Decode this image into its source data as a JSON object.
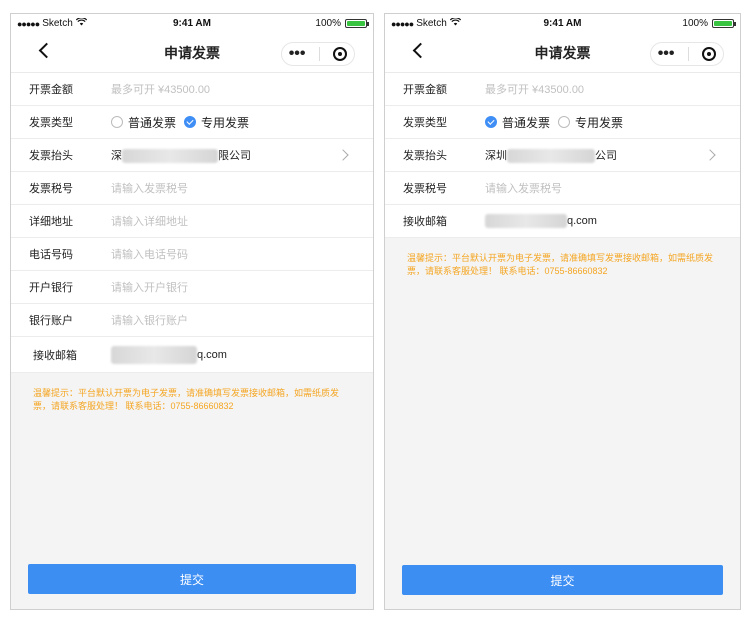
{
  "status_bar": {
    "carrier": "Sketch",
    "time": "9:41 AM",
    "battery": "100%"
  },
  "nav": {
    "title": "申请发票",
    "more_label": "•••"
  },
  "left_screen": {
    "rows": {
      "amount_label": "开票金额",
      "amount_placeholder": "最多可开 ¥43500.00",
      "type_label": "发票类型",
      "type_option_normal": "普通发票",
      "type_option_special": "专用发票",
      "selected_type": "专用发票",
      "header_label": "发票抬头",
      "header_value_prefix": "深",
      "header_value_suffix": "限公司",
      "tax_label": "发票税号",
      "tax_placeholder": "请输入发票税号",
      "address_label": "详细地址",
      "address_placeholder": "请输入详细地址",
      "phone_label": "电话号码",
      "phone_placeholder": "请输入电话号码",
      "bank_label": "开户银行",
      "bank_placeholder": "请输入开户银行",
      "account_label": "银行账户",
      "account_placeholder": "请输入银行账户",
      "email_label": "接收邮箱",
      "email_suffix": "q.com"
    },
    "tip": "温馨提示：平台默认开票为电子发票，请准确填写发票接收邮箱，如需纸质发票，请联系客服处理！ 联系电话：0755-86660832",
    "submit_label": "提交"
  },
  "right_screen": {
    "rows": {
      "amount_label": "开票金额",
      "amount_placeholder": "最多可开 ¥43500.00",
      "type_label": "发票类型",
      "type_option_normal": "普通发票",
      "type_option_special": "专用发票",
      "selected_type": "普通发票",
      "header_label": "发票抬头",
      "header_value_prefix": "深圳",
      "header_value_suffix": "公司",
      "tax_label": "发票税号",
      "tax_placeholder": "请输入发票税号",
      "email_label": "接收邮箱",
      "email_suffix": "q.com"
    },
    "tip": "温馨提示：平台默认开票为电子发票，请准确填写发票接收邮箱，如需纸质发票，请联系客服处理！ 联系电话：0755-86660832",
    "submit_label": "提交"
  },
  "colors": {
    "accent": "#3d8ef3",
    "tip": "#f5a623",
    "battery": "#38c441",
    "placeholder": "#c0c0c0"
  }
}
